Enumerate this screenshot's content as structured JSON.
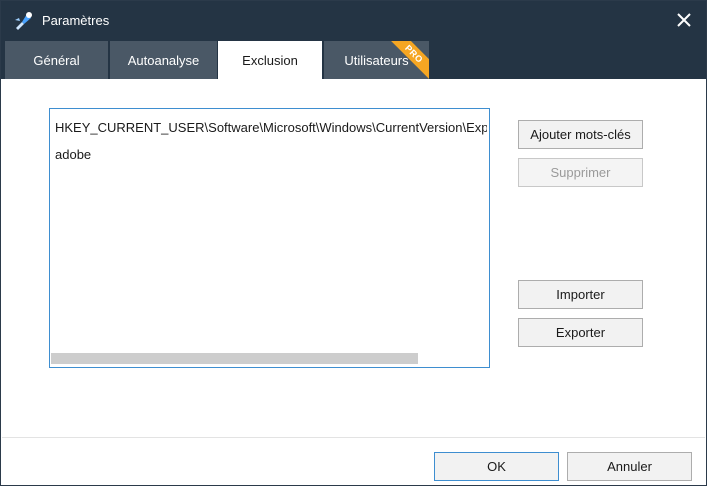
{
  "window": {
    "title": "Paramètres"
  },
  "tabs": [
    {
      "label": "Général",
      "active": false
    },
    {
      "label": "Autoanalyse",
      "active": false
    },
    {
      "label": "Exclusion",
      "active": true
    },
    {
      "label": "Utilisateurs",
      "active": false,
      "badge": "PRO"
    }
  ],
  "exclusion_list": {
    "items": [
      "HKEY_CURRENT_USER\\Software\\Microsoft\\Windows\\CurrentVersion\\Explorer",
      "adobe"
    ]
  },
  "side_buttons": {
    "add_keywords": "Ajouter mots-clés",
    "remove": "Supprimer",
    "import": "Importer",
    "export": "Exporter"
  },
  "footer": {
    "ok": "OK",
    "cancel": "Annuler"
  },
  "icons": {
    "app": "brush-wrench-icon",
    "close": "close-icon"
  },
  "colors": {
    "titlebar": "#243444",
    "tab_inactive": "#4a5866",
    "pro_badge": "#f5a623",
    "focus_border": "#3e8ed0"
  }
}
